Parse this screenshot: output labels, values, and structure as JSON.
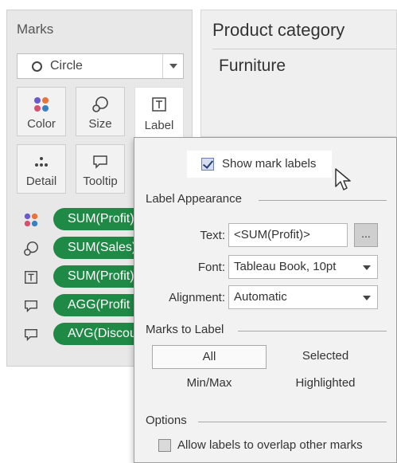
{
  "marks": {
    "title": "Marks",
    "mark_type": {
      "icon": "circle-icon",
      "value": "Circle"
    },
    "buttons": [
      {
        "label": "Color",
        "icon": "color-dots-icon"
      },
      {
        "label": "Size",
        "icon": "size-icon"
      },
      {
        "label": "Label",
        "icon": "label-icon"
      },
      {
        "label": "Detail",
        "icon": "detail-icon"
      },
      {
        "label": "Tooltip",
        "icon": "tooltip-icon"
      }
    ],
    "pills": [
      {
        "icon": "color-dots-icon",
        "text": "SUM(Profit)"
      },
      {
        "icon": "size-icon",
        "text": "SUM(Sales)"
      },
      {
        "icon": "label-icon",
        "text": "SUM(Profit)"
      },
      {
        "icon": "tooltip-icon",
        "text": "AGG(Profit Ratio)"
      },
      {
        "icon": "tooltip-icon",
        "text": "AVG(Discount)"
      }
    ],
    "pill_color": "#1f8a46"
  },
  "header": {
    "column": "Product category",
    "value": "Furniture"
  },
  "label_popup": {
    "show_mark_labels": {
      "label": "Show mark labels",
      "checked": true
    },
    "appearance": {
      "heading": "Label Appearance",
      "text_label": "Text:",
      "text_value": "<SUM(Profit)>",
      "text_button": "...",
      "font_label": "Font:",
      "font_value": "Tableau Book, 10pt",
      "alignment_label": "Alignment:",
      "alignment_value": "Automatic"
    },
    "marks_to_label": {
      "heading": "Marks to Label",
      "options": [
        "All",
        "Selected",
        "Min/Max",
        "Highlighted"
      ],
      "selected": "All"
    },
    "options": {
      "heading": "Options",
      "overlap_label": "Allow labels to overlap other marks",
      "overlap_checked": false
    }
  }
}
